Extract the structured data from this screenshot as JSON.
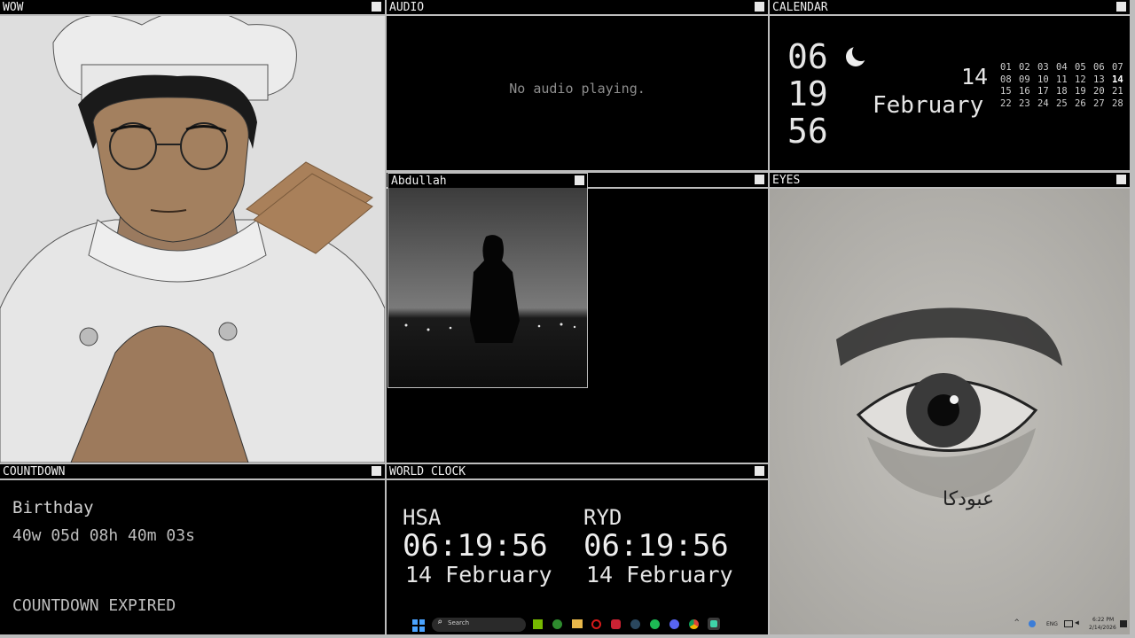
{
  "panels": {
    "wow": {
      "title": "WOW"
    },
    "audio": {
      "title": "AUDIO",
      "status": "No audio playing."
    },
    "calendar": {
      "title": "CALENDAR",
      "time": {
        "hour": "06",
        "minute": "19",
        "second": "56"
      },
      "day": "14",
      "month": "February",
      "days_rows": [
        [
          "01",
          "02",
          "03",
          "04",
          "05",
          "06",
          "07"
        ],
        [
          "08",
          "09",
          "10",
          "11",
          "12",
          "13",
          "14"
        ],
        [
          "15",
          "16",
          "17",
          "18",
          "19",
          "20",
          "21"
        ],
        [
          "22",
          "23",
          "24",
          "25",
          "26",
          "27",
          "28"
        ]
      ],
      "today": "14"
    },
    "abdullah": {
      "title": "Abdullah"
    },
    "eyes": {
      "title": "EYES",
      "signature": "عبودكا"
    },
    "countdown": {
      "title": "COUNTDOWN",
      "event": "Birthday",
      "remaining": "40w 05d 08h 40m 03s",
      "status": "COUNTDOWN EXPIRED"
    },
    "world_clock": {
      "title": "WORLD CLOCK",
      "clocks": [
        {
          "city": "HSA",
          "time": "06:19:56",
          "date": "14 February"
        },
        {
          "city": "RYD",
          "time": "06:19:56",
          "date": "14 February"
        }
      ]
    }
  },
  "taskbar": {
    "search_placeholder": "Search",
    "tray": {
      "lang": "ENG",
      "time": "6:22 PM",
      "date": "2/14/2026"
    }
  }
}
